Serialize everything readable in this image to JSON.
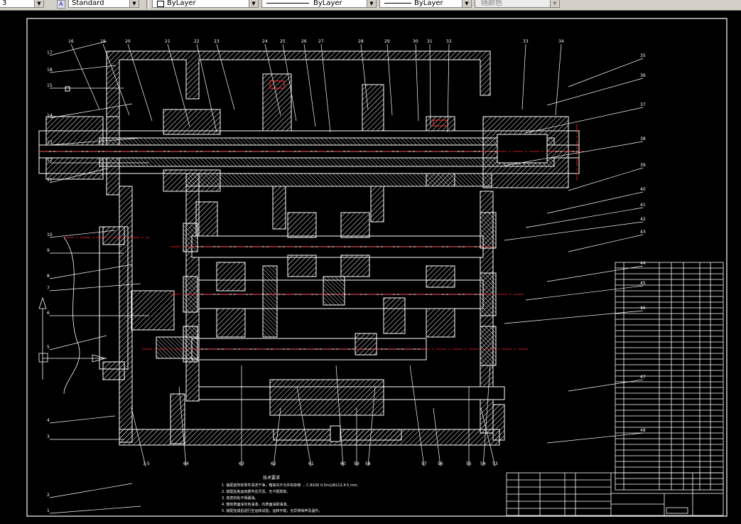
{
  "toolbar": {
    "left_stub": "3",
    "text_style": "Standard",
    "layer": "ByLayer",
    "linetype": "ByLayer",
    "lineweight": "ByLayer",
    "plot_color": "随颜色"
  },
  "drawing": {
    "notes_title": "技术要求",
    "notes": [
      "1. 装配前所有零件清洗干净，箱体内不允许有杂物 ... C.B100 0.5m以B112.4.5 mm.",
      "2. 装配后各运动部件应灵活，无卡阻现象。",
      "3. 各密封处不得漏油。",
      "4. 箱体表面涂灰色油漆，内表面涂耐油漆。",
      "5. 装配完成后进行空运转试验，运转平稳，无异常噪声及温升。"
    ],
    "callouts_top": [
      "16",
      "19",
      "20",
      "21",
      "22",
      "23",
      "24",
      "25",
      "26",
      "27",
      "28",
      "29",
      "30",
      "31",
      "32",
      "33",
      "34"
    ],
    "callouts_right": [
      "35",
      "36",
      "37",
      "38",
      "39",
      "40",
      "41",
      "42",
      "43",
      "44",
      "45",
      "46",
      "47",
      "48"
    ],
    "callouts_left": [
      "17",
      "18",
      "15",
      "14",
      "13",
      "12",
      "11",
      "10",
      "9",
      "8",
      "7",
      "6",
      "5",
      "4",
      "3",
      "2",
      "1"
    ],
    "callouts_bottom": [
      "3-5",
      "64",
      "63",
      "62",
      "61",
      "60",
      "59",
      "58",
      "57",
      "56",
      "55",
      "54",
      "53"
    ],
    "colors": {
      "border": "#ffffff",
      "part_line": "#ffffff",
      "center_line": "#ff2020",
      "leader": "#ffffff",
      "highlight": "#ff3030"
    }
  }
}
